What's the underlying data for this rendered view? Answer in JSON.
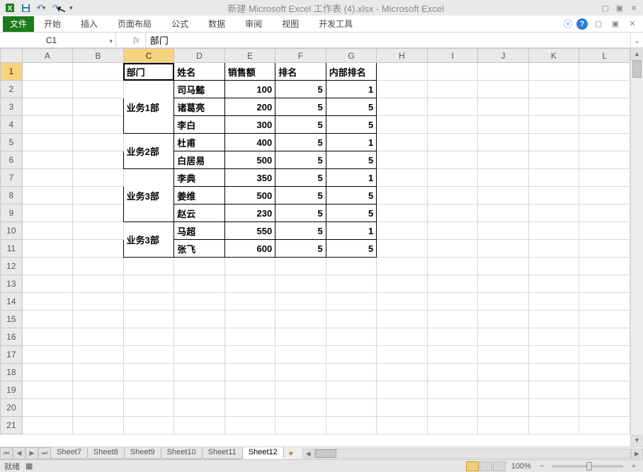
{
  "app": {
    "title": "新建 Microsoft Excel 工作表 (4).xlsx  -  Microsoft Excel"
  },
  "ribbon": {
    "file": "文件",
    "tabs": [
      "开始",
      "插入",
      "页面布局",
      "公式",
      "数据",
      "审阅",
      "视图",
      "开发工具"
    ]
  },
  "namebox": "C1",
  "formula": "部门",
  "columns": [
    "A",
    "B",
    "C",
    "D",
    "E",
    "F",
    "G",
    "H",
    "I",
    "J",
    "K",
    "L"
  ],
  "rows": 21,
  "active_cell": {
    "row": 1,
    "col_index": 2
  },
  "table": {
    "headers": [
      "部门",
      "姓名",
      "销售额",
      "排名",
      "内部排名"
    ],
    "rows": [
      {
        "dept": "业务1部",
        "name": "司马懿",
        "sales": 100,
        "rank": 5,
        "inner": 1
      },
      {
        "dept": "",
        "name": "诸葛亮",
        "sales": 200,
        "rank": 5,
        "inner": 5
      },
      {
        "dept": "",
        "name": "李白",
        "sales": 300,
        "rank": 5,
        "inner": 5
      },
      {
        "dept": "业务2部",
        "name": "杜甫",
        "sales": 400,
        "rank": 5,
        "inner": 1
      },
      {
        "dept": "",
        "name": "白居易",
        "sales": 500,
        "rank": 5,
        "inner": 5
      },
      {
        "dept": "业务3部",
        "name": "李典",
        "sales": 350,
        "rank": 5,
        "inner": 1
      },
      {
        "dept": "",
        "name": "姜维",
        "sales": 500,
        "rank": 5,
        "inner": 5
      },
      {
        "dept": "",
        "name": "赵云",
        "sales": 230,
        "rank": 5,
        "inner": 5
      },
      {
        "dept": "业务3部",
        "name": "马超",
        "sales": 550,
        "rank": 5,
        "inner": 1
      },
      {
        "dept": "",
        "name": "张飞",
        "sales": 600,
        "rank": 5,
        "inner": 5
      }
    ],
    "merges": [
      {
        "start": 2,
        "span": 3,
        "label": "业务1部"
      },
      {
        "start": 5,
        "span": 2,
        "label": "业务2部"
      },
      {
        "start": 7,
        "span": 3,
        "label": "业务3部"
      },
      {
        "start": 10,
        "span": 2,
        "label": "业务3部"
      }
    ]
  },
  "sheet_tabs": [
    "Sheet7",
    "Sheet8",
    "Sheet9",
    "Sheet10",
    "Sheet11",
    "Sheet12"
  ],
  "active_sheet": "Sheet12",
  "status": {
    "ready": "就绪",
    "zoom": "100%"
  },
  "chart_data": {
    "type": "table",
    "columns": [
      "部门",
      "姓名",
      "销售额",
      "排名",
      "内部排名"
    ],
    "data": [
      [
        "业务1部",
        "司马懿",
        100,
        5,
        1
      ],
      [
        "业务1部",
        "诸葛亮",
        200,
        5,
        5
      ],
      [
        "业务1部",
        "李白",
        300,
        5,
        5
      ],
      [
        "业务2部",
        "杜甫",
        400,
        5,
        1
      ],
      [
        "业务2部",
        "白居易",
        500,
        5,
        5
      ],
      [
        "业务3部",
        "李典",
        350,
        5,
        1
      ],
      [
        "业务3部",
        "姜维",
        500,
        5,
        5
      ],
      [
        "业务3部",
        "赵云",
        230,
        5,
        5
      ],
      [
        "业务3部",
        "马超",
        550,
        5,
        1
      ],
      [
        "业务3部",
        "张飞",
        600,
        5,
        5
      ]
    ]
  }
}
